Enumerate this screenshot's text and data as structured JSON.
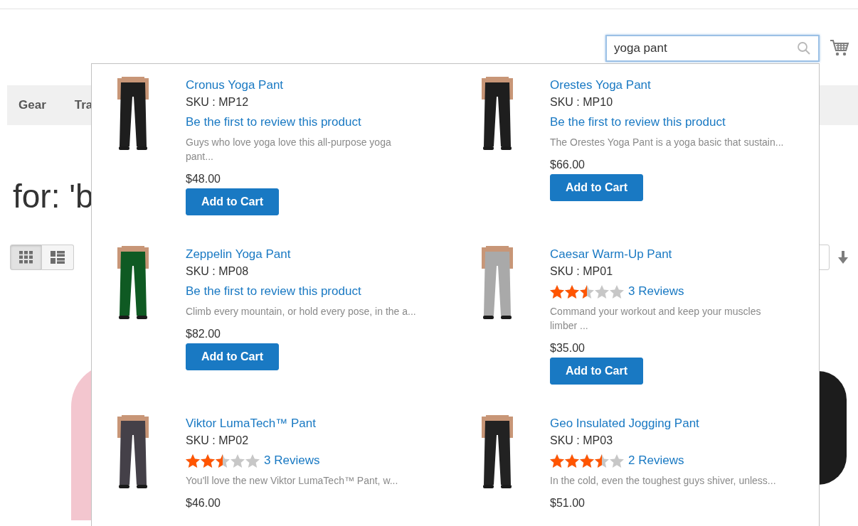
{
  "search": {
    "value": "yoga pant"
  },
  "nav": {
    "items": [
      {
        "label": "Gear"
      },
      {
        "label": "Tra"
      }
    ]
  },
  "heading": "for: 'b",
  "view_modes": [
    {
      "kind": "grid",
      "selected": true
    },
    {
      "kind": "list",
      "selected": false
    }
  ],
  "products": [
    {
      "name": "Cronus Yoga Pant",
      "sku": "SKU : MP12",
      "review_link": "Be the first to review this product",
      "description": "Guys who love yoga love this all-purpose yoga pant...",
      "price": "$48.00",
      "button": "Add to Cart",
      "color": "#1e1e1e"
    },
    {
      "name": "Orestes Yoga Pant",
      "sku": "SKU : MP10",
      "review_link": "Be the first to review this product",
      "description": "The Orestes Yoga Pant is a yoga basic that sustain...",
      "price": "$66.00",
      "button": "Add to Cart",
      "color": "#1e1e1e"
    },
    {
      "name": "Zeppelin Yoga Pant",
      "sku": "SKU : MP08",
      "review_link": "Be the first to review this product",
      "description": "Climb every mountain, or hold every pose, in the a...",
      "price": "$82.00",
      "button": "Add to Cart",
      "color": "#0f5a23"
    },
    {
      "name": "Caesar Warm-Up Pant",
      "sku": "SKU : MP01",
      "stars": 2.5,
      "review_link": "3 Reviews",
      "description": "Command your workout and keep your muscles limber ...",
      "price": "$35.00",
      "button": "Add to Cart",
      "color": "#a9a9a9"
    },
    {
      "name": "Viktor LumaTech™ Pant",
      "sku": "SKU : MP02",
      "stars": 2.5,
      "review_link": "3 Reviews",
      "description": "You'll love the new Viktor LumaTech™ Pant, w...",
      "price": "$46.00",
      "color": "#444048"
    },
    {
      "name": "Geo Insulated Jogging Pant",
      "sku": "SKU : MP03",
      "stars": 3.5,
      "review_link": "2 Reviews",
      "description": "In the cold, even the toughest guys shiver, unless...",
      "price": "$51.00",
      "color": "#222222"
    }
  ]
}
